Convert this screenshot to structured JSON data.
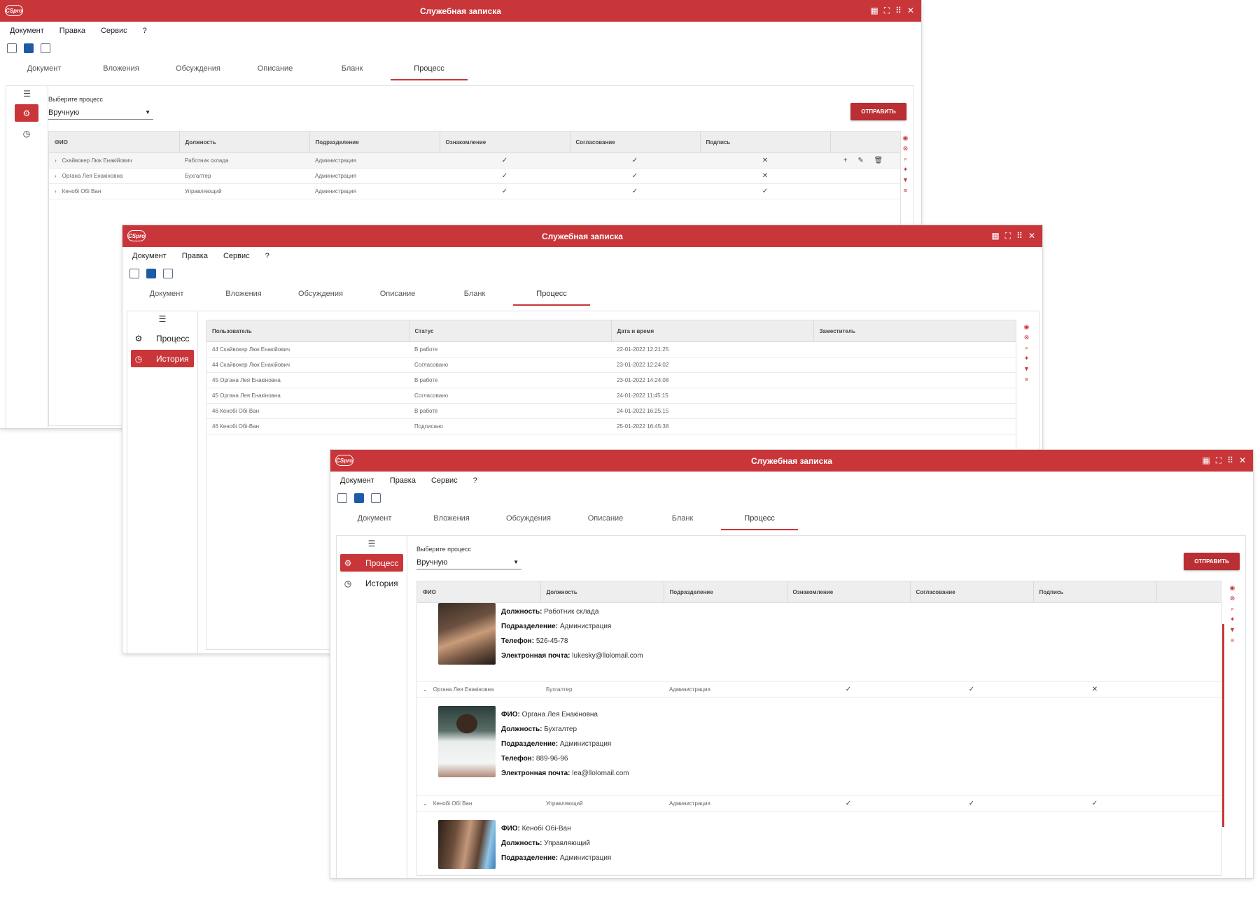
{
  "brand_color": "#c9363a",
  "window": {
    "title": "Служебная записка",
    "logo": "CSpro",
    "controls": [
      "grid-icon",
      "expand-icon",
      "dots-icon",
      "close-icon"
    ],
    "menu": [
      "Документ",
      "Правка",
      "Сервис",
      "?"
    ],
    "toolbar": [
      "print-icon",
      "save-icon",
      "exit-icon"
    ],
    "tabs": [
      "Документ",
      "Вложения",
      "Обсуждения",
      "Описание",
      "Бланк",
      "Процесс"
    ],
    "active_tab": "Процесс"
  },
  "process_form": {
    "select_label": "Выберите процесс",
    "select_value": "Вручную",
    "send_button": "ОТПРАВИТЬ",
    "columns": [
      "ФИО",
      "Должность",
      "Подразделение",
      "Ознакомление",
      "Согласование",
      "Подпись"
    ],
    "rows": [
      {
        "fio": "Скайвокер Люк Енакійович",
        "position": "Работник склада",
        "dept": "Администрация",
        "familiarize": "✓",
        "approve": "✓",
        "sign": "✕"
      },
      {
        "fio": "Органа Лея Енакіновна",
        "position": "Бухгалтер",
        "dept": "Администрация",
        "familiarize": "✓",
        "approve": "✓",
        "sign": "✕"
      },
      {
        "fio": "Кенобі Обі Ван",
        "position": "Управляющий",
        "dept": "Администрация",
        "familiarize": "✓",
        "approve": "✓",
        "sign": "✓"
      }
    ],
    "row_actions": "+ ✎ 🗑"
  },
  "sidebar": {
    "process": "Процесс",
    "history": "История"
  },
  "history": {
    "columns": [
      "Пользователь",
      "Статус",
      "Дата и время",
      "Заместитель"
    ],
    "rows": [
      {
        "user": "44 Скайвокер Люк Енакійович",
        "status": "В работе",
        "datetime": "22-01-2022 12:21:25",
        "deputy": ""
      },
      {
        "user": "44 Скайвокер Люк Енакійович",
        "status": "Согласовано",
        "datetime": "23-01-2022 12:24:02",
        "deputy": ""
      },
      {
        "user": "45 Органа Лея Енакіновна",
        "status": "В работе",
        "datetime": "23-01-2022 14:24:08",
        "deputy": ""
      },
      {
        "user": "45 Органа Лея Енакіновна",
        "status": "Согласовано",
        "datetime": "24-01-2022 11:45:15",
        "deputy": ""
      },
      {
        "user": "46 Кенобі Обі-Ван",
        "status": "В работе",
        "datetime": "24-01-2022 16:25:15",
        "deputy": ""
      },
      {
        "user": "46 Кенобі Обі-Ван",
        "status": "Подписано",
        "datetime": "25-01-2022 16:45:38",
        "deputy": ""
      }
    ]
  },
  "expanded": {
    "labels": {
      "fio": "ФИО:",
      "position": "Должность:",
      "dept": "Подразделение:",
      "phone": "Телефон:",
      "email": "Электронная почта:"
    },
    "luke": {
      "position": "Работник склада",
      "dept": "Администрация",
      "phone": "526-45-78",
      "email": "lukesky@llolomail.com"
    },
    "leia_row": {
      "fio": "Органа Лея Енакіновна",
      "position": "Бухгалтер",
      "dept": "Администрация",
      "familiarize": "✓",
      "approve": "✓",
      "sign": "✕"
    },
    "leia": {
      "fio": "Органа Лея Енакіновна",
      "position": "Бухгалтер",
      "dept": "Администрация",
      "phone": "889-96-96",
      "email": "lea@llolomail.com"
    },
    "obi_row": {
      "fio": "Кенобі Обі Ван",
      "position": "Управляющий",
      "dept": "Администрация",
      "familiarize": "✓",
      "approve": "✓",
      "sign": "✓"
    },
    "obi": {
      "fio": "Кенобі Обі-Ван",
      "position": "Управляющий",
      "dept": "Администрация"
    }
  }
}
